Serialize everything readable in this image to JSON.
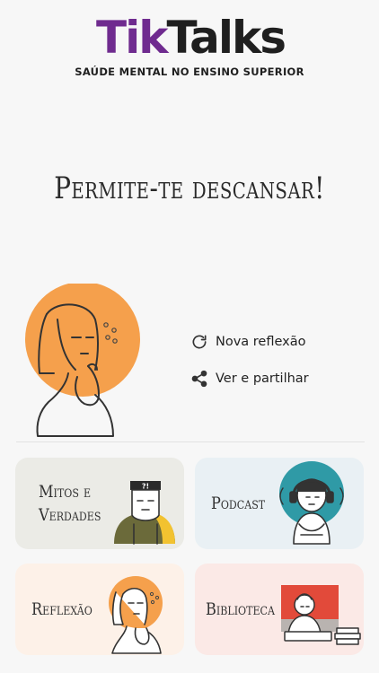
{
  "header": {
    "logo_part1": "Tik",
    "logo_part2": "Talks",
    "tagline": "SAÚDE MENTAL NO ENSINO SUPERIOR"
  },
  "headline": "Permite-te descansar!",
  "actions": {
    "refresh_label": "Nova reflexão",
    "share_label": "Ver e partilhar"
  },
  "cards": [
    {
      "label_line1": "Mitos e",
      "label_line2": "Verdades",
      "icon": "question-person-icon"
    },
    {
      "label": "Podcast",
      "icon": "headphones-person-icon"
    },
    {
      "label": "Reflexão",
      "icon": "thinking-person-icon"
    },
    {
      "label": "Biblioteca",
      "icon": "reading-person-icon"
    }
  ],
  "mitos_badge": "?!",
  "colors": {
    "brand_purple": "#6f2b8f",
    "orange": "#f5a04c",
    "teal": "#2f9aa6",
    "red": "#e24a3a",
    "olive": "#6b6a3a",
    "yellow": "#f2c230"
  }
}
